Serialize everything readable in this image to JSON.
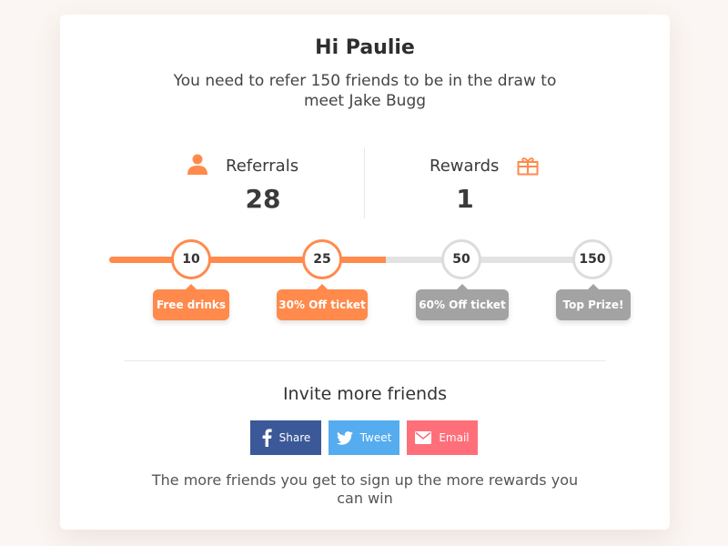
{
  "greeting": "Hi Paulie",
  "subtitle": "You need to refer 150 friends to be in the draw to meet Jake Bugg",
  "stats": {
    "referrals": {
      "label": "Referrals",
      "value": "28",
      "icon": "user-icon"
    },
    "rewards": {
      "label": "Rewards",
      "value": "1",
      "icon": "gift-icon"
    }
  },
  "progress": {
    "fraction": 0.55,
    "milestones": [
      {
        "value": "10",
        "reward": "Free drinks",
        "state": "active"
      },
      {
        "value": "25",
        "reward": "30% Off ticket",
        "state": "active"
      },
      {
        "value": "50",
        "reward": "60% Off ticket",
        "state": "locked"
      },
      {
        "value": "150",
        "reward": "Top Prize!",
        "state": "locked"
      }
    ]
  },
  "invite": {
    "title": "Invite more friends",
    "buttons": [
      {
        "label": "Share",
        "icon": "facebook-icon",
        "color": "#3b5998"
      },
      {
        "label": "Tweet",
        "icon": "twitter-icon",
        "color": "#55acee"
      },
      {
        "label": "Email",
        "icon": "email-icon",
        "color": "#ff6f7a"
      }
    ]
  },
  "footer": "The more friends you get to sign up the more rewards you can win",
  "colors": {
    "accent": "#ff8a4c",
    "locked": "#a3a3a3",
    "track": "#e2e2e2"
  }
}
